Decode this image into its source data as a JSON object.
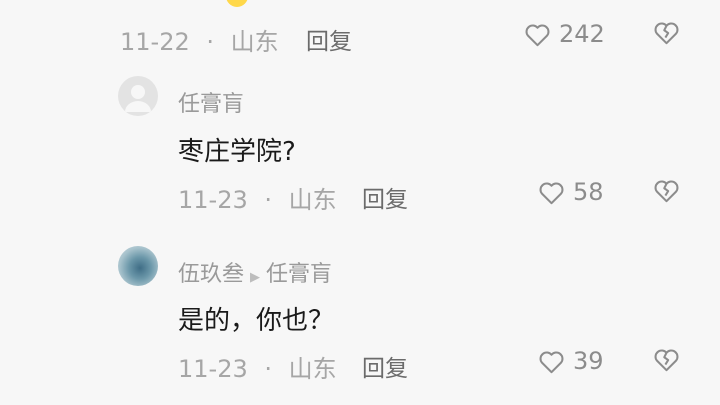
{
  "comments": [
    {
      "date": "11-22",
      "sep": "·",
      "location": "山东",
      "reply_label": "回复",
      "likes": "242"
    },
    {
      "username": "任膏肓",
      "text": "枣庄学院?",
      "date": "11-23",
      "sep": "·",
      "location": "山东",
      "reply_label": "回复",
      "likes": "58"
    },
    {
      "username": "伍玖叁",
      "reply_to": "任膏肓",
      "text": "是的，你也？",
      "date": "11-23",
      "sep": "·",
      "location": "山东",
      "reply_label": "回复",
      "likes": "39"
    }
  ],
  "icons": {
    "like": "heart-outline-icon",
    "dislike": "broken-heart-icon",
    "reply_arrow": "play-arrow-icon"
  },
  "colors": {
    "background": "#f7f7f7",
    "meta": "#a6a6a6",
    "content": "#1a1a1a",
    "icon": "#8c8c8c"
  }
}
